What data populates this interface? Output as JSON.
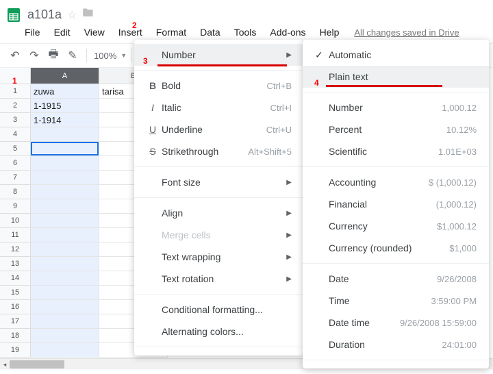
{
  "header": {
    "title": "a101a"
  },
  "menubar": {
    "file": "File",
    "edit": "Edit",
    "view": "View",
    "insert": "Insert",
    "format": "Format",
    "data": "Data",
    "tools": "Tools",
    "addons": "Add-ons",
    "help": "Help",
    "saved": "All changes saved in Drive"
  },
  "toolbar": {
    "zoom": "100%"
  },
  "sheet": {
    "cols": [
      "A",
      "B"
    ],
    "rows": [
      {
        "a": "zuwa",
        "b": "tarisa"
      },
      {
        "a": "1-1915",
        "b": ""
      },
      {
        "a": "1-1914",
        "b": ""
      },
      {
        "a": "",
        "b": ""
      },
      {
        "a": "",
        "b": ""
      },
      {
        "a": "",
        "b": ""
      },
      {
        "a": "",
        "b": ""
      },
      {
        "a": "",
        "b": ""
      },
      {
        "a": "",
        "b": ""
      },
      {
        "a": "",
        "b": ""
      },
      {
        "a": "",
        "b": ""
      },
      {
        "a": "",
        "b": ""
      },
      {
        "a": "",
        "b": ""
      },
      {
        "a": "",
        "b": ""
      },
      {
        "a": "",
        "b": ""
      },
      {
        "a": "",
        "b": ""
      },
      {
        "a": "",
        "b": ""
      },
      {
        "a": "",
        "b": ""
      },
      {
        "a": "",
        "b": ""
      }
    ]
  },
  "formatMenu": {
    "number": "Number",
    "bold": "Bold",
    "bold_sc": "Ctrl+B",
    "italic": "Italic",
    "italic_sc": "Ctrl+I",
    "underline": "Underline",
    "underline_sc": "Ctrl+U",
    "strike": "Strikethrough",
    "strike_sc": "Alt+Shift+5",
    "fontsize": "Font size",
    "align": "Align",
    "merge": "Merge cells",
    "wrap": "Text wrapping",
    "rotate": "Text rotation",
    "cond": "Conditional formatting...",
    "alt": "Alternating colors..."
  },
  "numberMenu": {
    "automatic": "Automatic",
    "plaintext": "Plain text",
    "number": "Number",
    "number_ex": "1,000.12",
    "percent": "Percent",
    "percent_ex": "10.12%",
    "scientific": "Scientific",
    "scientific_ex": "1.01E+03",
    "accounting": "Accounting",
    "accounting_ex": "$ (1,000.12)",
    "financial": "Financial",
    "financial_ex": "(1,000.12)",
    "currency": "Currency",
    "currency_ex": "$1,000.12",
    "currencyr": "Currency (rounded)",
    "currencyr_ex": "$1,000",
    "date": "Date",
    "date_ex": "9/26/2008",
    "time": "Time",
    "time_ex": "3:59:00 PM",
    "datetime": "Date time",
    "datetime_ex": "9/26/2008 15:59:00",
    "duration": "Duration",
    "duration_ex": "24:01:00"
  },
  "annotations": {
    "n1": "1",
    "n2": "2",
    "n3": "3",
    "n4": "4"
  }
}
